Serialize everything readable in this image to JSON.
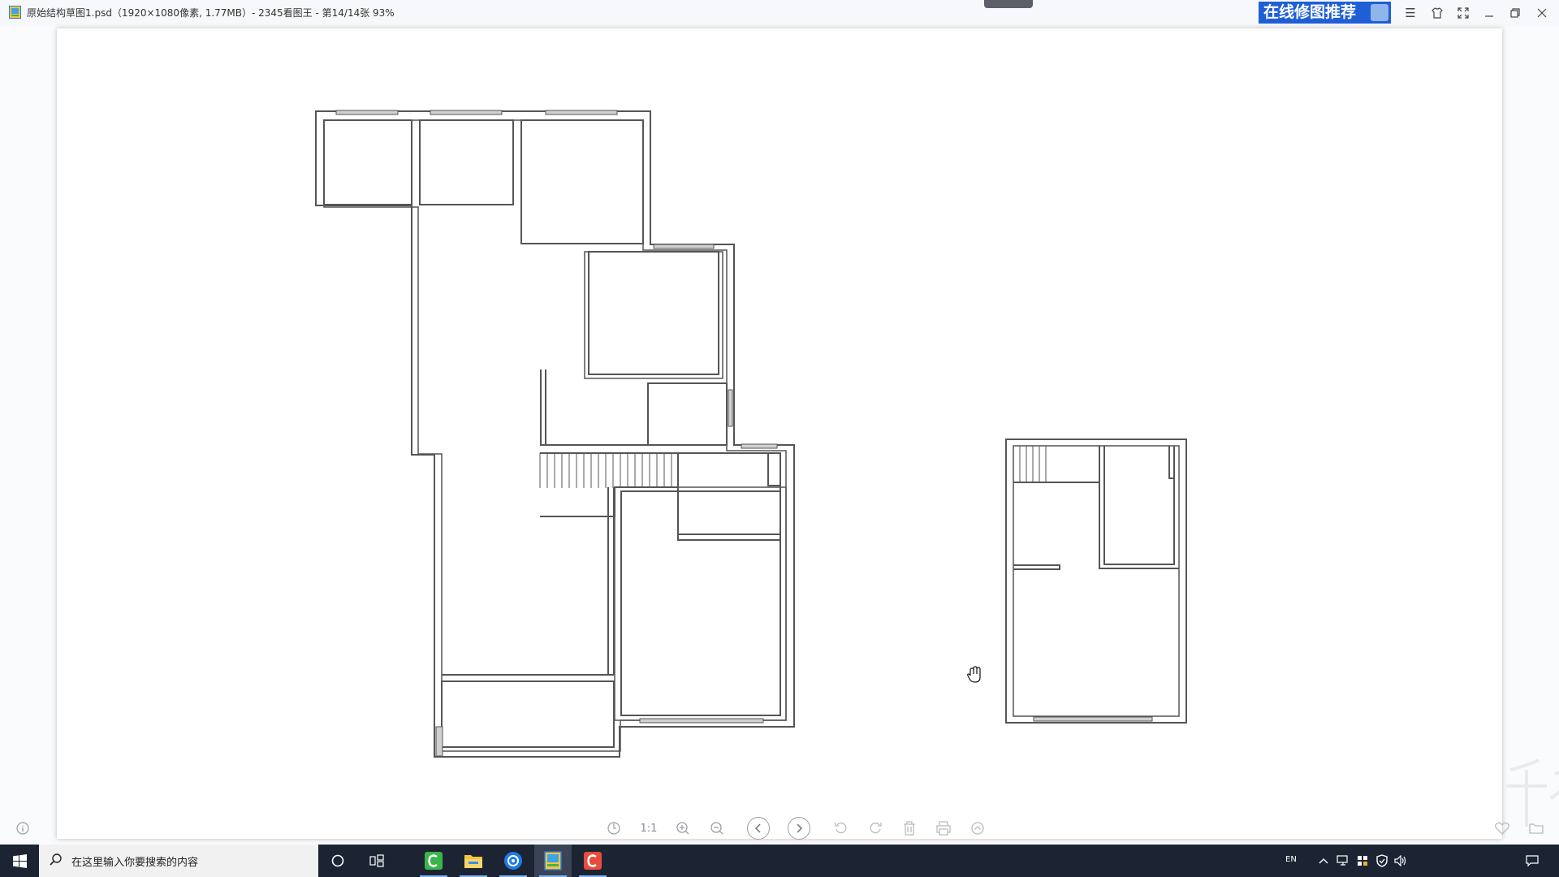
{
  "window": {
    "title": "原始结构草图1.psd（1920×1080像素, 1.77MB）- 2345看图王 - 第14/14张 93%",
    "promo_label": "在线修图推荐",
    "controls": {
      "menu_icon": "hamburger-icon",
      "skin_icon": "shirt-icon",
      "fullscreen_icon": "expand-icon",
      "minimize_icon": "minimize-icon",
      "restore_icon": "restore-icon",
      "close_icon": "close-icon"
    }
  },
  "toolbar": {
    "ratio_label": "1:1",
    "buttons": [
      "info-icon",
      "rotate-pin-icon",
      "actual-size",
      "zoom-in-icon",
      "zoom-out-icon",
      "prev-icon",
      "next-icon",
      "rotate-left-icon",
      "rotate-right-icon",
      "delete-icon",
      "print-icon",
      "more-up-icon",
      "favorite-icon",
      "folder-icon"
    ]
  },
  "taskbar": {
    "search_placeholder": "在这里输入你要搜索的内容",
    "lang": "EN",
    "apps": [
      "cortana-icon",
      "task-view-icon",
      "green-c-app-icon",
      "file-explorer-icon",
      "blue-app-icon",
      "image-viewer-icon",
      "red-c-app-icon"
    ]
  },
  "colors": {
    "promo_bg": "#1f5fd6",
    "taskbar_bg": "#1c2434",
    "plan_stroke": "#555555"
  }
}
